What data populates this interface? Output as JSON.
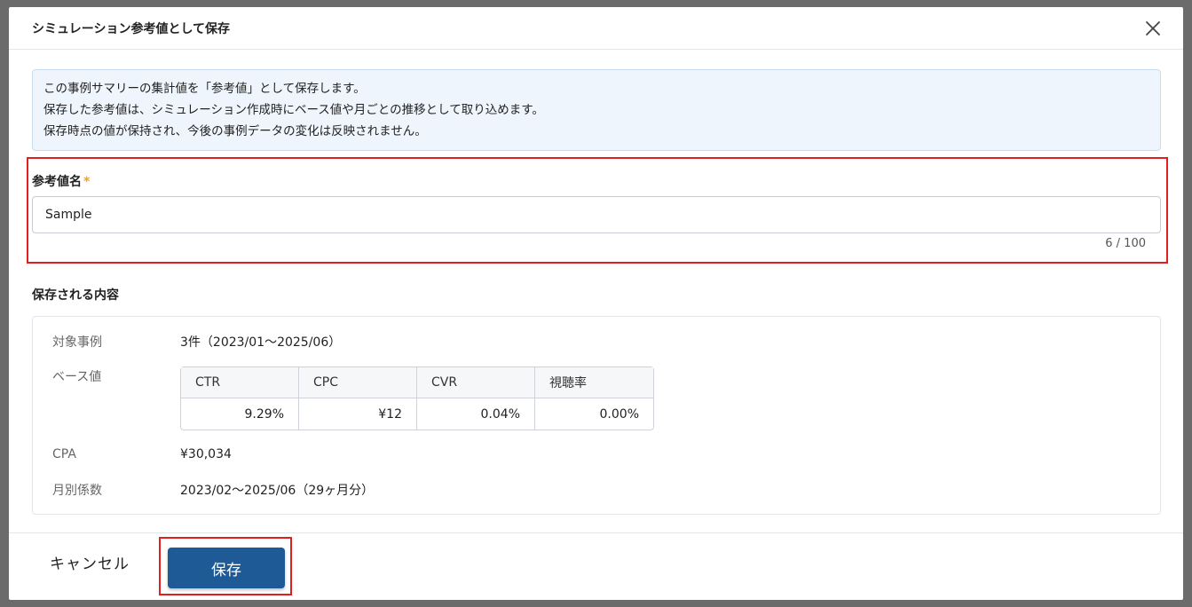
{
  "dialog": {
    "title": "シミュレーション参考値として保存",
    "close_icon": "close-icon"
  },
  "info": {
    "lines": [
      "この事例サマリーの集計値を「参考値」として保存します。",
      "保存した参考値は、シミュレーション作成時にベース値や月ごとの推移として取り込めます。",
      "保存時点の値が保持され、今後の事例データの変化は反映されません。"
    ]
  },
  "name_field": {
    "label": "参考値名",
    "required_mark": "*",
    "value": "Sample",
    "counter": "6 / 100"
  },
  "summary": {
    "title": "保存される内容",
    "target_label": "対象事例",
    "target_value": "3件（2023/01〜2025/06）",
    "base_label": "ベース値",
    "metrics": {
      "headers": [
        "CTR",
        "CPC",
        "CVR",
        "視聴率"
      ],
      "values": [
        "9.29%",
        "¥12",
        "0.04%",
        "0.00%"
      ]
    },
    "cpa_label": "CPA",
    "cpa_value": "¥30,034",
    "monthly_label": "月別係数",
    "monthly_value": "2023/02〜2025/06（29ヶ月分）"
  },
  "footer": {
    "cancel_label": "キャンセル",
    "save_label": "保存"
  },
  "colors": {
    "primary": "#1e5a96",
    "highlight": "#e01f1f",
    "info_bg": "#eef5fc",
    "required": "#f0a020"
  }
}
